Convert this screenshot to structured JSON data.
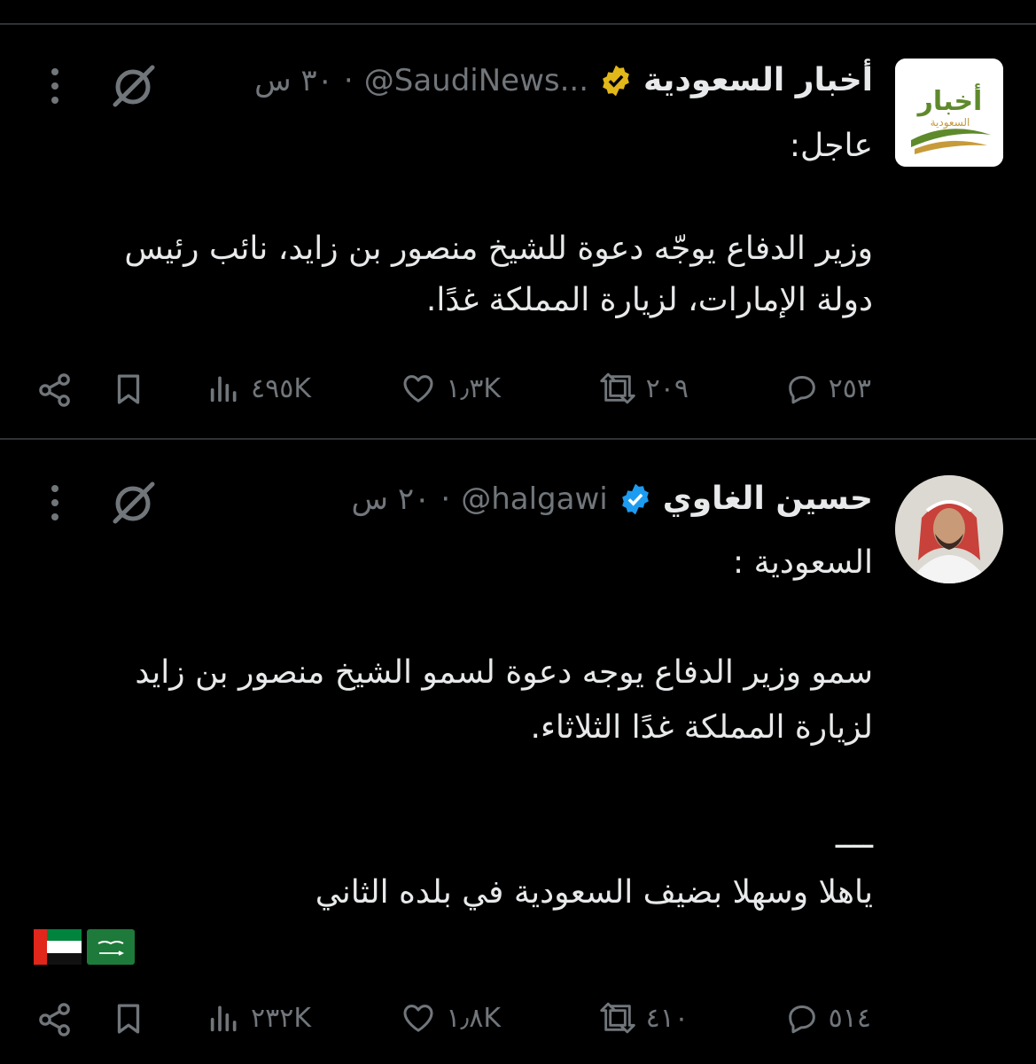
{
  "tweets": [
    {
      "author_name": "أخبار السعودية",
      "handle": "@SaudiNews...",
      "time": "٣٠ س",
      "verified": "gold",
      "avatar_text": "أخبار",
      "avatar_subtext": "السعودية",
      "lines": [
        "عاجل:",
        "",
        "وزير الدفاع يوجّه دعوة للشيخ منصور بن زايد، نائب رئيس",
        "دولة الإمارات، لزيارة المملكة غدًا."
      ],
      "replies": "٢٥٣",
      "retweets": "٢٠٩",
      "likes": "١٫٣K",
      "views": "٤٩٥K"
    },
    {
      "author_name": "حسين الغاوي",
      "handle": "@halgawi",
      "time": "٢٠ س",
      "verified": "blue",
      "lines": [
        "السعودية :",
        "",
        "سمو وزير الدفاع يوجه دعوة لسمو الشيخ منصور بن زايد",
        "لزيارة المملكة غدًا الثلاثاء.",
        "",
        "ــــ",
        "ياهلا وسهلا بضيف السعودية في بلده الثاني"
      ],
      "flags": [
        "uae-flag",
        "saudi-flag"
      ],
      "replies": "٥١٤",
      "retweets": "٤١٠",
      "likes": "١٫٨K",
      "views": "٢٣٢K"
    }
  ],
  "colors": {
    "bg": "#000000",
    "text": "#e7e9ea",
    "muted": "#71767b",
    "gold": "#e2b719",
    "blue": "#1d9bf0"
  }
}
